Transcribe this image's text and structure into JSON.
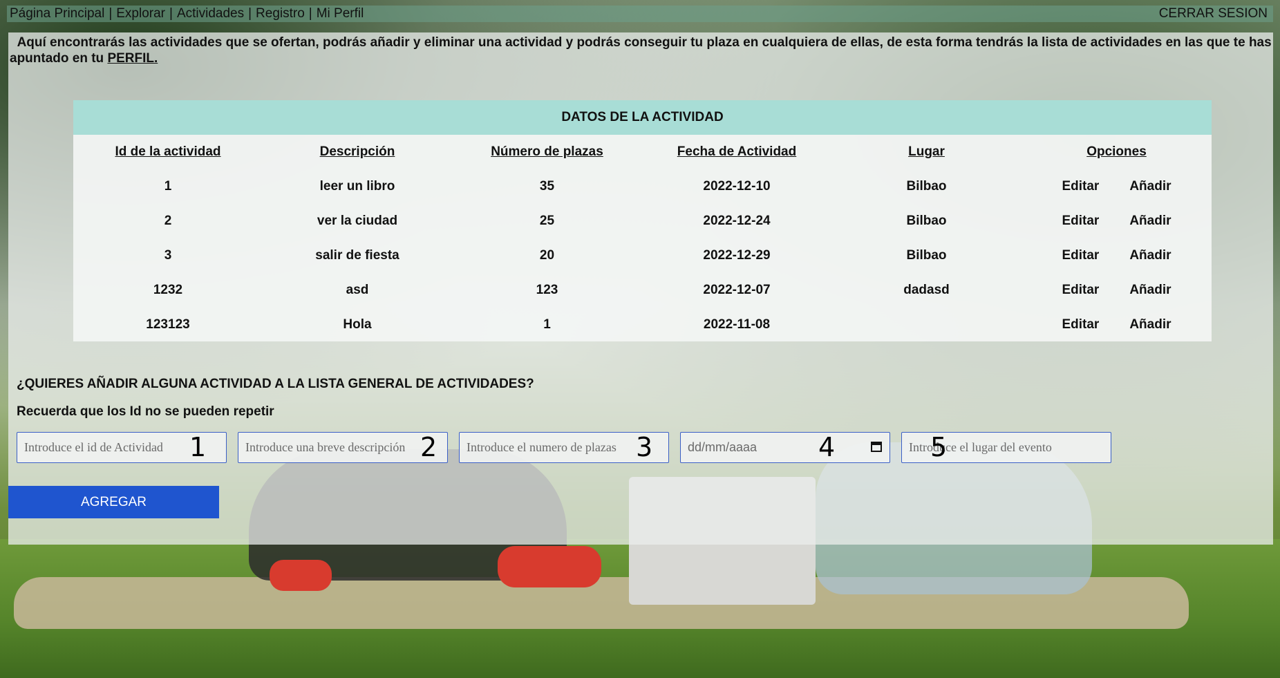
{
  "nav": {
    "links": [
      "Página Principal",
      "Explorar",
      "Actividades",
      "Registro",
      "Mi Perfil"
    ],
    "logout": "CERRAR SESION"
  },
  "intro": {
    "text": "Aquí encontrarás las actividades que se ofertan, podrás añadir y eliminar una actividad y podrás conseguir tu plaza en cualquiera de ellas, de esta forma tendrás la lista de actividades en las que te has apuntado en tu",
    "link": "PERFIL."
  },
  "table": {
    "title": "DATOS DE LA ACTIVIDAD",
    "headers": [
      "Id de la actividad",
      "Descripción",
      "Número de plazas",
      "Fecha de Actividad",
      "Lugar",
      "Opciones"
    ],
    "rows": [
      {
        "id": "1",
        "desc": "leer un libro",
        "plazas": "35",
        "fecha": "2022-12-10",
        "lugar": "Bilbao"
      },
      {
        "id": "2",
        "desc": "ver la ciudad",
        "plazas": "25",
        "fecha": "2022-12-24",
        "lugar": "Bilbao"
      },
      {
        "id": "3",
        "desc": "salir de fiesta",
        "plazas": "20",
        "fecha": "2022-12-29",
        "lugar": "Bilbao"
      },
      {
        "id": "1232",
        "desc": "asd",
        "plazas": "123",
        "fecha": "2022-12-07",
        "lugar": "dadasd"
      },
      {
        "id": "123123",
        "desc": "Hola",
        "plazas": "1",
        "fecha": "2022-11-08",
        "lugar": ""
      }
    ],
    "edit_label": "Editar",
    "add_label": "Añadir"
  },
  "form": {
    "question": "¿QUIERES AÑADIR ALGUNA ACTIVIDAD A LA LISTA GENERAL DE ACTIVIDADES?",
    "reminder": "Recuerda que los Id no se pueden repetir",
    "fields": [
      {
        "placeholder": "Introduce el id de Actividad",
        "annotation": "1"
      },
      {
        "placeholder": "Introduce una breve descripción",
        "annotation": "2"
      },
      {
        "placeholder": "Introduce el numero de plazas",
        "annotation": "3"
      },
      {
        "placeholder": "dd/mm/aaaa",
        "annotation": "4"
      },
      {
        "placeholder": "Introduce el lugar del evento",
        "annotation": "5"
      }
    ],
    "submit_label": "AGREGAR"
  },
  "colors": {
    "accent": "#1f55cf",
    "table_header": "#a8ddd6",
    "input_border": "#3b5fc6"
  }
}
